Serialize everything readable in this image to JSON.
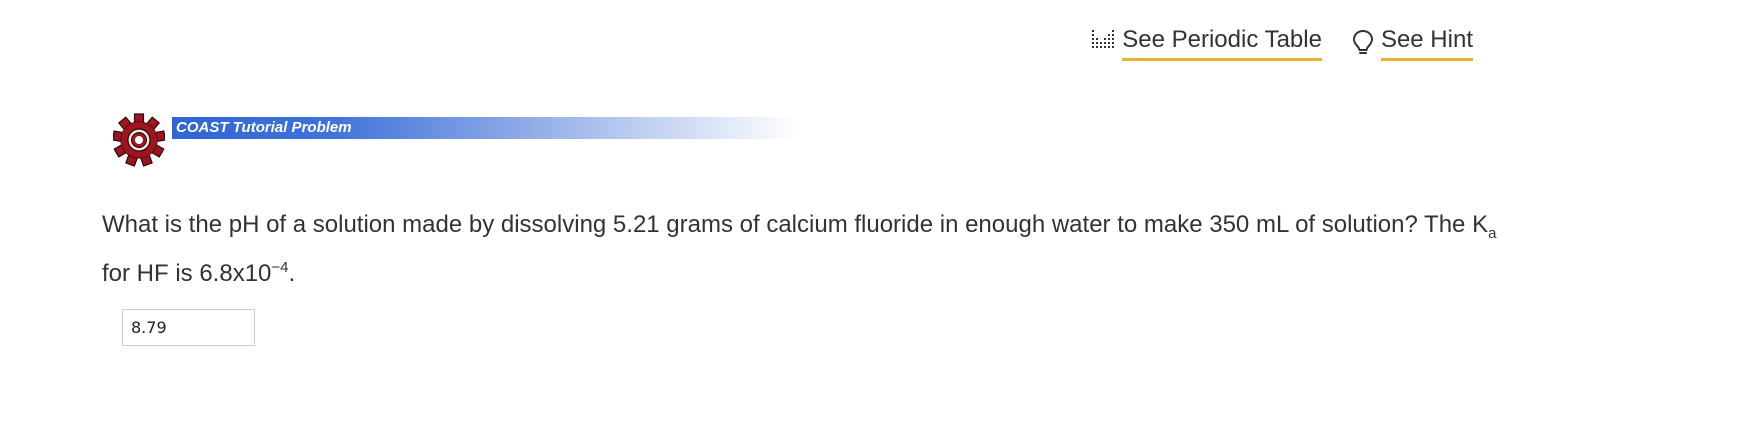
{
  "toolbar": {
    "periodic_table_label": "See Periodic Table",
    "periodic_table_icon": "periodic-table-icon",
    "hint_label": "See Hint",
    "hint_icon": "lightbulb-icon",
    "underline_color": "#e8b332"
  },
  "banner": {
    "label": "COAST Tutorial Problem",
    "icon": "gear-icon",
    "gear_color": "#a0141e",
    "bar_color": "#2f66d6"
  },
  "question": {
    "text_1": "What is the pH of a solution made by dissolving 5.21 grams of calcium fluoride in enough water to make 350 mL of solution? The K",
    "k_subscript": "a",
    "text_2": " for HF is 6.8x10",
    "exponent": "−4",
    "text_3": "."
  },
  "answer": {
    "value": "8.79"
  }
}
